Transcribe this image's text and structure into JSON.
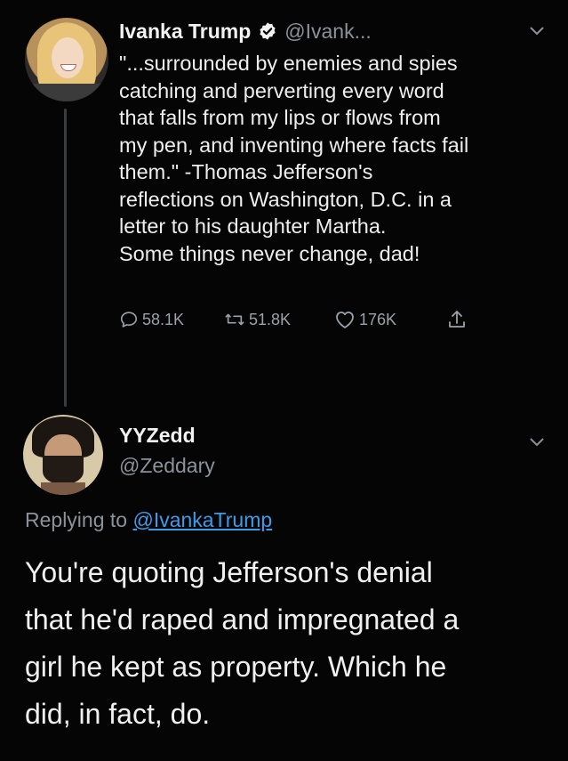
{
  "tweet1": {
    "author_name": "Ivanka Trump",
    "author_handle": "@Ivank...",
    "verified_icon": "verified-badge-icon",
    "text_lines": [
      "\"...surrounded by enemies and spies",
      "catching and perverting every word",
      "that falls from my lips or flows from",
      "my pen, and inventing where facts fail",
      "them.\" -Thomas Jefferson's",
      "reflections on Washington, D.C. in a",
      "letter to his daughter Martha.",
      "Some things never change, dad!"
    ],
    "replies": "58.1K",
    "retweets": "51.8K",
    "likes": "176K"
  },
  "tweet2": {
    "author_name": "YYZedd",
    "author_handle": "@Zeddary",
    "replying_prefix": "Replying to ",
    "replying_to": "@IvankaTrump",
    "text_lines": [
      "You're quoting Jefferson's denial",
      "that he'd raped and impregnated a",
      "girl he kept as property. Which he",
      "did, in fact, do."
    ]
  },
  "colors": {
    "background": "#050505",
    "text": "#eeeeee",
    "secondary": "#8b9299",
    "link": "#3d9be9"
  }
}
